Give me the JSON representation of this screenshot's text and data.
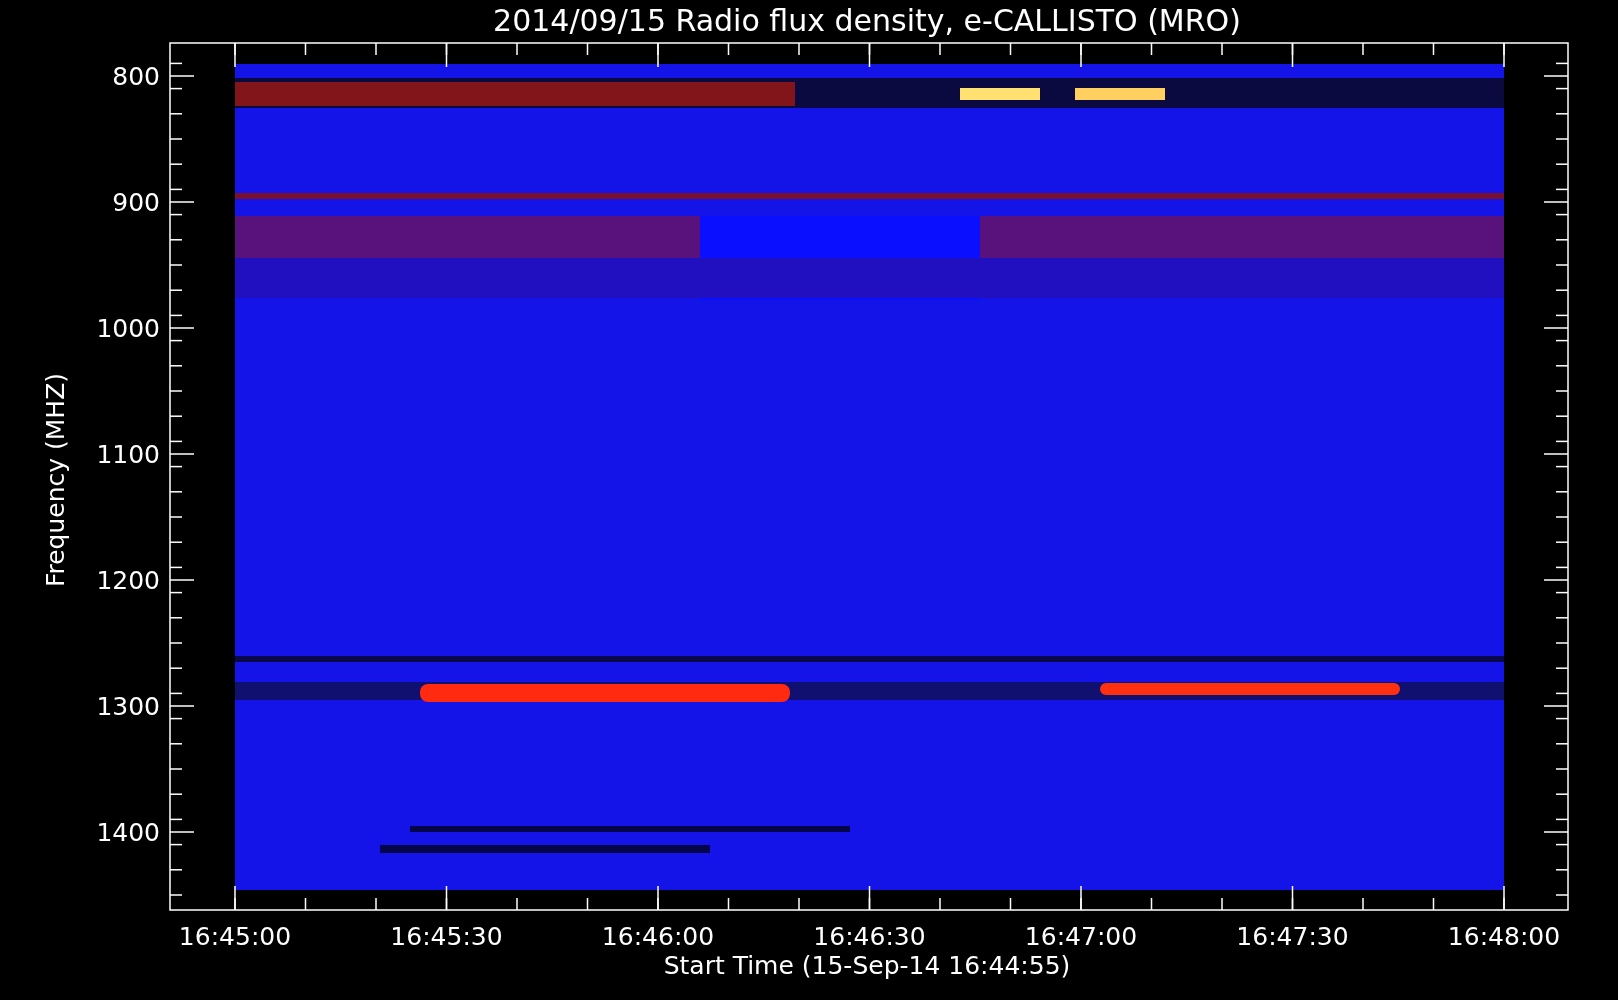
{
  "title": "2014/09/15  Radio flux density, e-CALLISTO (MRO)",
  "ylabel": "Frequency (MHZ)",
  "xlabel": "Start Time (15-Sep-14 16:44:55)",
  "yticks": [
    "800",
    "900",
    "1000",
    "1100",
    "1200",
    "1300",
    "1400"
  ],
  "xticks": [
    "16:45:00",
    "16:45:30",
    "16:46:00",
    "16:46:30",
    "16:47:00",
    "16:47:30",
    "16:48:00"
  ]
}
